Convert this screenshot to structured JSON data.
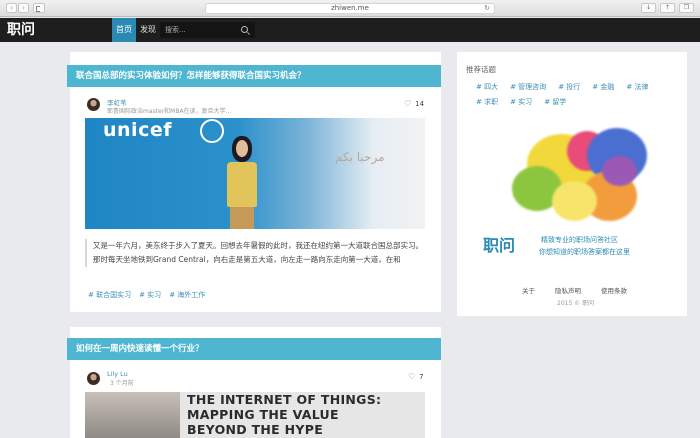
{
  "browser": {
    "url": "zhiwen.me",
    "back": "‹",
    "forward": "›"
  },
  "header": {
    "logo": "职问",
    "nav": [
      "首页",
      "发现"
    ],
    "search_placeholder": "搜索..."
  },
  "posts": [
    {
      "title": "联合国总部的实习体验如何？怎样能够获得联合国实习机会？",
      "author": "李虹苇",
      "author_sub": "耶鲁国际政治master和MBA在读，复旦大学...",
      "likes": "14",
      "image_text": "unicef",
      "image_text2": "مرحبا بكم",
      "excerpt": "又是一年六月，美东终于步入了夏天。回想去年暑假的此时，我还在纽约第一大道联合国总部实习。那时每天坐地铁到Grand Central，向右走是第五大道，向左走一路向东走向第一大道，在和",
      "tags": [
        "# 联合国实习",
        "# 实习",
        "# 海外工作"
      ]
    },
    {
      "title": "如何在一周内快速读懂一个行业？",
      "author": "Lily Lu",
      "author_sub": "3 个月前",
      "likes": "7",
      "image_lines": [
        "THE INTERNET OF THINGS:",
        "MAPPING THE VALUE",
        "BEYOND THE HYPE"
      ]
    }
  ],
  "sidebar": {
    "title": "推荐话题",
    "topics": [
      "# 四大",
      "# 管理咨询",
      "# 投行",
      "# 金融",
      "# 法律",
      "# 求职",
      "# 实习",
      "# 留学"
    ],
    "promo_logo": "职问",
    "promo_line1": "精致专业的职场问答社区",
    "promo_line2": "你想知道的职场答案都在这里",
    "footer_links": [
      "关于",
      "隐私声明",
      "使用条款"
    ],
    "copyright": "2015 © 职问"
  },
  "colors": {
    "accent": "#4eb6d0",
    "link": "#3b8fb8",
    "header_bg": "#1e1e1e"
  }
}
